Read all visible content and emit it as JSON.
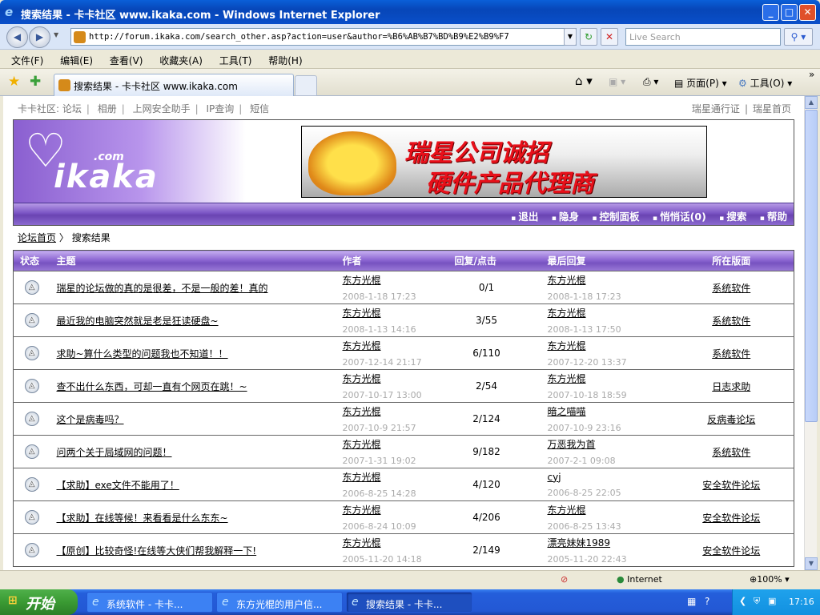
{
  "window": {
    "title": "搜索结果 - 卡卡社区 www.ikaka.com - Windows Internet Explorer"
  },
  "toolbar": {
    "url": "http://forum.ikaka.com/search_other.asp?action=user&author=%B6%AB%B7%BD%B9%E2%B9%F7",
    "search_placeholder": "Live Search"
  },
  "menu": [
    "文件(F)",
    "编辑(E)",
    "查看(V)",
    "收藏夹(A)",
    "工具(T)",
    "帮助(H)"
  ],
  "tab": {
    "title": "搜索结果 - 卡卡社区 www.ikaka.com"
  },
  "commandbar": {
    "page": "页面(P)",
    "tools": "工具(O)"
  },
  "site": {
    "toplinks": [
      "卡卡社区: 论坛",
      "相册",
      "上网安全助手",
      "IP查询",
      "短信"
    ],
    "toplinks_right": [
      "瑞星通行证",
      "瑞星首页"
    ],
    "logo_text": "ikaka",
    "logo_com": ".com",
    "banner": {
      "line1": "瑞星公司诚招",
      "line2": "硬件产品代理商"
    },
    "nav": [
      "退出",
      "隐身",
      "控制面板",
      "悄悄话(0)",
      "搜索",
      "帮助"
    ],
    "breadcrumb": {
      "home": "论坛首页",
      "sep": "〉",
      "current": "搜索结果"
    }
  },
  "table": {
    "headers": [
      "状态",
      "主题",
      "作者",
      "回复/点击",
      "最后回复",
      "所在版面"
    ],
    "rows": [
      {
        "subject": "瑞星的论坛做的真的是很差，不是一般的差！真的",
        "author": "东方光棍",
        "author_date": "2008-1-18 17:23",
        "stats": "0/1",
        "last": "东方光棍",
        "last_date": "2008-1-18 17:23",
        "forum": "系统软件"
      },
      {
        "subject": "最近我的电脑突然就是老是狂读硬盘~",
        "author": "东方光棍",
        "author_date": "2008-1-13 14:16",
        "stats": "3/55",
        "last": "东方光棍",
        "last_date": "2008-1-13 17:50",
        "forum": "系统软件"
      },
      {
        "subject": "求助~算什么类型的问题我也不知道！！",
        "author": "东方光棍",
        "author_date": "2007-12-14 21:17",
        "stats": "6/110",
        "last": "东方光棍",
        "last_date": "2007-12-20 13:37",
        "forum": "系统软件"
      },
      {
        "subject": "查不出什么东西，可却一直有个网页在跳！~",
        "author": "东方光棍",
        "author_date": "2007-10-17 13:00",
        "stats": "2/54",
        "last": "东方光棍",
        "last_date": "2007-10-18 18:59",
        "forum": "日志求助"
      },
      {
        "subject": "这个是病毒吗？",
        "author": "东方光棍",
        "author_date": "2007-10-9 21:57",
        "stats": "2/124",
        "last": "暗之喵喵",
        "last_date": "2007-10-9 23:16",
        "forum": "反病毒论坛"
      },
      {
        "subject": "问两个关于局域网的问题！",
        "author": "东方光棍",
        "author_date": "2007-1-31 19:02",
        "stats": "9/182",
        "last": "万恶我为首",
        "last_date": "2007-2-1 09:08",
        "forum": "系统软件"
      },
      {
        "subject": "【求助】exe文件不能用了！",
        "author": "东方光棍",
        "author_date": "2006-8-25 14:28",
        "stats": "4/120",
        "last": "cyj",
        "last_date": "2006-8-25 22:05",
        "forum": "安全软件论坛"
      },
      {
        "subject": "【求助】在线等候！来看看是什么东东~",
        "author": "东方光棍",
        "author_date": "2006-8-24 10:09",
        "stats": "4/206",
        "last": "东方光棍",
        "last_date": "2006-8-25 13:43",
        "forum": "安全软件论坛"
      },
      {
        "subject": "【原创】比较奇怪!在线等大侠们帮我解释一下!",
        "author": "东方光棍",
        "author_date": "2005-11-20 14:18",
        "stats": "2/149",
        "last": "漂亮妹妹1989",
        "last_date": "2005-11-20 22:43",
        "forum": "安全软件论坛"
      }
    ]
  },
  "statusbar": {
    "zone": "Internet",
    "zoom": "100%"
  },
  "taskbar": {
    "start": "开始",
    "tasks": [
      "系统软件 - 卡卡...",
      "东方光棍的用户信...",
      "搜索结果 - 卡卡..."
    ],
    "clock": "17:16"
  }
}
